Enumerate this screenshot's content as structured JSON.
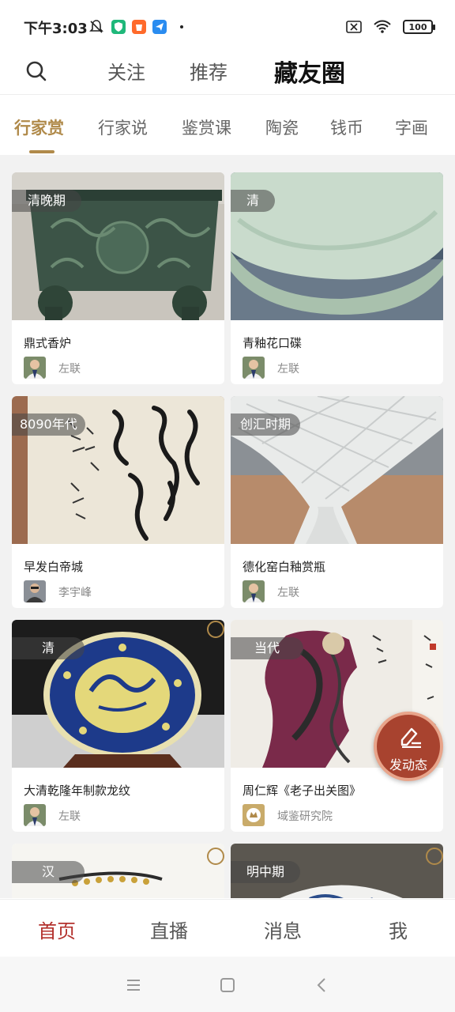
{
  "status_bar": {
    "time": "下午3:03",
    "battery": "100"
  },
  "header": {
    "tabs": [
      "关注",
      "推荐",
      "藏友圈"
    ],
    "active_tab": "藏友圈"
  },
  "categories": {
    "items": [
      "行家赏",
      "行家说",
      "鉴赏课",
      "陶瓷",
      "钱币",
      "字画"
    ],
    "active": "行家赏",
    "accent_color": "#b08a4a"
  },
  "feed": {
    "cards": [
      {
        "era": "清晚期",
        "title": "鼎式香炉",
        "author": "左联"
      },
      {
        "era": "清",
        "title": "青釉花口碟",
        "author": "左联"
      },
      {
        "era": "8090年代",
        "title": "早发白帝城",
        "author": "李宇峰"
      },
      {
        "era": "创汇时期",
        "title": "德化窑白釉赏瓶",
        "author": "左联"
      },
      {
        "era": "清",
        "title": "大清乾隆年制款龙纹",
        "author": "左联"
      },
      {
        "era": "当代",
        "title": "周仁辉《老子出关图》",
        "author": "域鉴研究院"
      },
      {
        "era": "汉"
      },
      {
        "era": "明中期"
      }
    ]
  },
  "fab": {
    "label": "发动态",
    "color": "#a8432f"
  },
  "bottom_nav": {
    "items": [
      "首页",
      "直播",
      "消息",
      "我"
    ],
    "active": "首页",
    "active_color": "#b3312d"
  }
}
